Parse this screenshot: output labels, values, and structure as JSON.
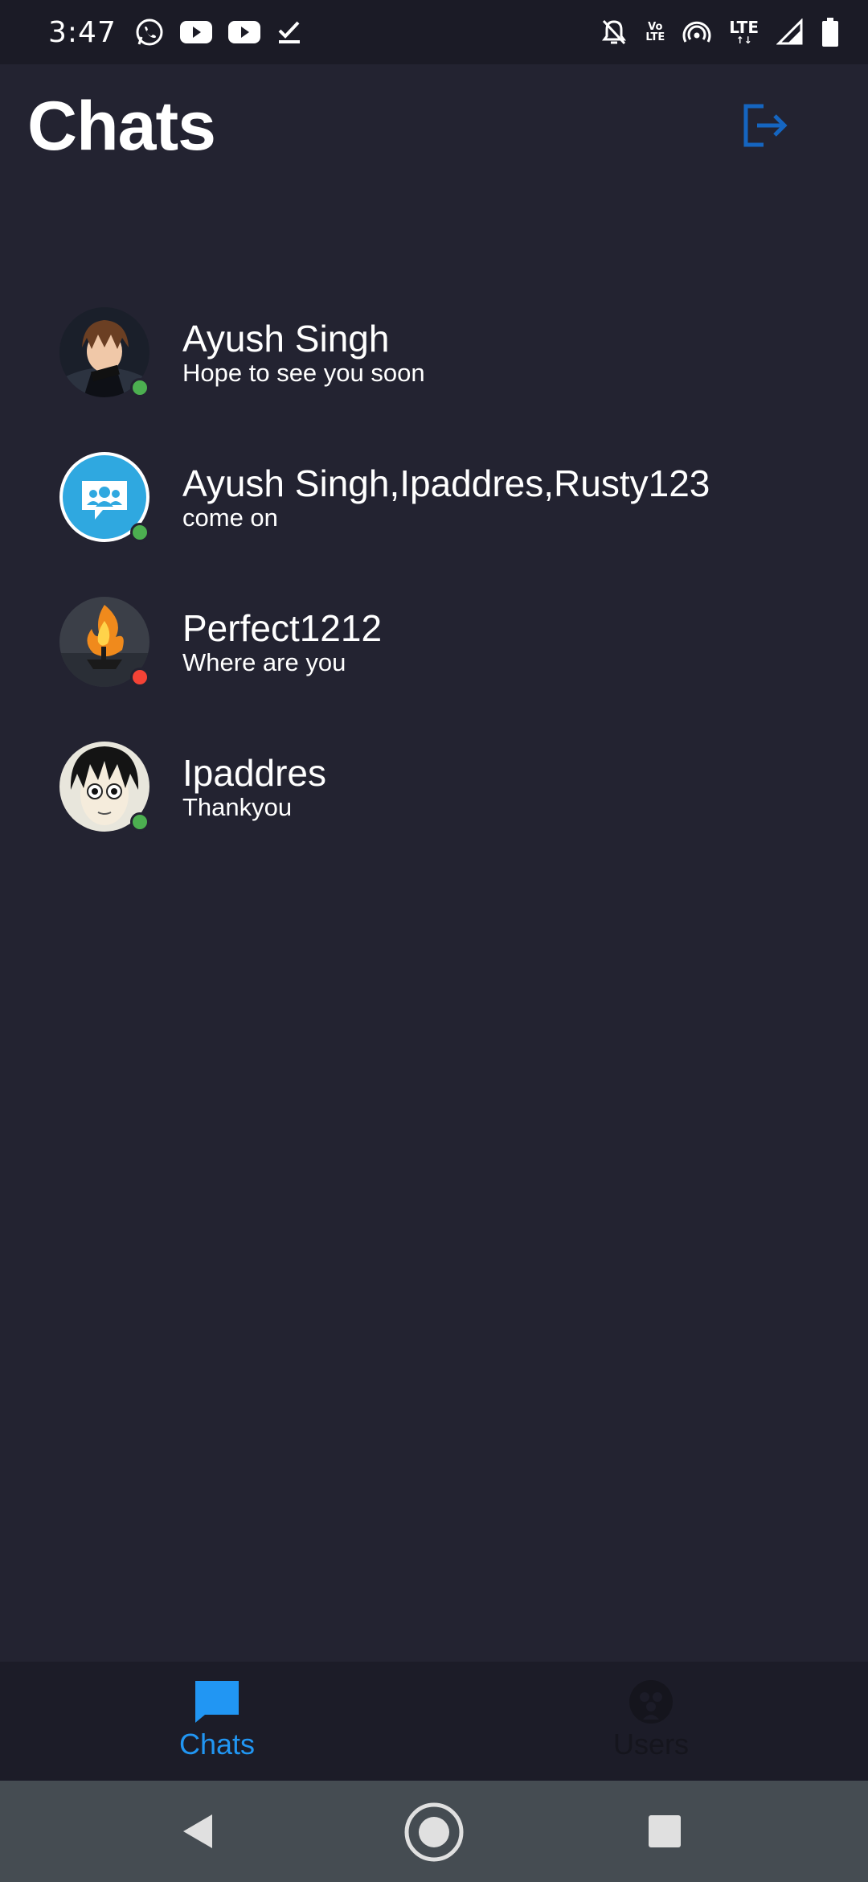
{
  "status_bar": {
    "time": "3:47",
    "left_icons": [
      "whatsapp-icon",
      "youtube-icon",
      "youtube-icon",
      "checkmark-icon"
    ],
    "right_icons": [
      "bell-off-icon",
      "volte-icon",
      "hotspot-icon",
      "lte-icon",
      "signal-icon",
      "battery-icon"
    ],
    "volte_label_top": "Vo",
    "volte_label_bottom": "LTE",
    "lte_label": "LTE"
  },
  "header": {
    "title": "Chats",
    "logout_icon": "logout-icon"
  },
  "chats": [
    {
      "name": "Ayush Singh",
      "last_message": "Hope to see you soon",
      "status": "online",
      "avatar": "anime-boy-avatar"
    },
    {
      "name": "Ayush Singh,Ipaddres,Rusty123",
      "last_message": "come on",
      "status": "online",
      "avatar": "group-chat-avatar"
    },
    {
      "name": "Perfect1212",
      "last_message": "Where are you",
      "status": "offline",
      "avatar": "fire-avatar"
    },
    {
      "name": "Ipaddres",
      "last_message": "Thankyou",
      "status": "online",
      "avatar": "anime-face-avatar"
    }
  ],
  "bottom_nav": {
    "tabs": [
      {
        "label": "Chats",
        "icon": "chat-bubble-icon",
        "active": true
      },
      {
        "label": "Users",
        "icon": "users-icon",
        "active": false
      }
    ]
  },
  "colors": {
    "background": "#232331",
    "accent": "#2196f3",
    "online": "#4caf50",
    "offline": "#f44336",
    "logout": "#1565c0"
  }
}
